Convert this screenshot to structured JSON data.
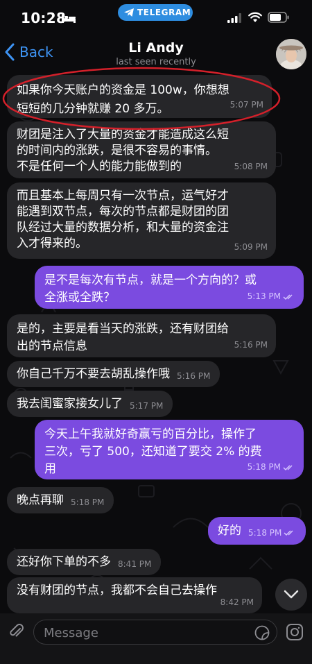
{
  "status_bar": {
    "time": "10:28",
    "app_pill": "TELEGRAM"
  },
  "header": {
    "back_label": "Back",
    "chat_name": "Li Andy",
    "chat_status": "last seen recently"
  },
  "messages": [
    {
      "direction": "in",
      "lines": [
        "如果你今天账户的资金是 100w，你想想",
        "短短的几分钟就赚 20 多万。"
      ],
      "time": "5:07 PM"
    },
    {
      "direction": "in",
      "lines": [
        "财团是注入了大量的资金才能造成这么短",
        "的时间内的涨跌，是很不容易的事情。",
        "不是任何一个人的能力能做到的"
      ],
      "time": "5:08 PM"
    },
    {
      "direction": "in",
      "lines": [
        "而且基本上每周只有一次节点，运气好才",
        "能遇到双节点，每次的节点都是财团的团",
        "队经过大量的数据分析，和大量的资金注",
        "入才得来的。"
      ],
      "time": "5:09 PM"
    },
    {
      "direction": "out",
      "lines": [
        "是不是每次有节点，就是一个方向的？或",
        "全涨或全跌？"
      ],
      "time": "5:13 PM"
    },
    {
      "direction": "in",
      "lines": [
        "是的，主要是看当天的涨跌，还有财团给",
        "出的节点信息"
      ],
      "time": "5:16 PM"
    },
    {
      "direction": "in",
      "lines": [
        "你自己千万不要去胡乱操作哦"
      ],
      "time": "5:16 PM"
    },
    {
      "direction": "in",
      "lines": [
        "我去闺蜜家接女儿了"
      ],
      "time": "5:17 PM"
    },
    {
      "direction": "out",
      "lines": [
        "今天上午我就好奇赢亏的百分比，操作了",
        "三次，亏了 500，还知道了要交 2% 的费",
        "用"
      ],
      "time": "5:18 PM"
    },
    {
      "direction": "in",
      "lines": [
        "晚点再聊"
      ],
      "time": "5:18 PM"
    },
    {
      "direction": "out",
      "lines": [
        "好的"
      ],
      "time": "5:18 PM"
    },
    {
      "direction": "in",
      "lines": [
        "还好你下单的不多"
      ],
      "time": "8:41 PM"
    },
    {
      "direction": "in",
      "lines": [
        "没有财团的节点，我都不会自己去操作"
      ],
      "time": "8:42 PM"
    }
  ],
  "input": {
    "placeholder": "Message"
  },
  "icons": {
    "back": "chevron-left-icon",
    "attach": "paperclip-icon",
    "sticker": "sticker-icon",
    "camera": "instagram-camera-icon",
    "scroll": "chevron-down-icon"
  },
  "colors": {
    "accent": "#3e94f4",
    "outgoing_bubble": "#7b4be0",
    "incoming_bubble": "#262629",
    "highlight": "#d4202a"
  }
}
